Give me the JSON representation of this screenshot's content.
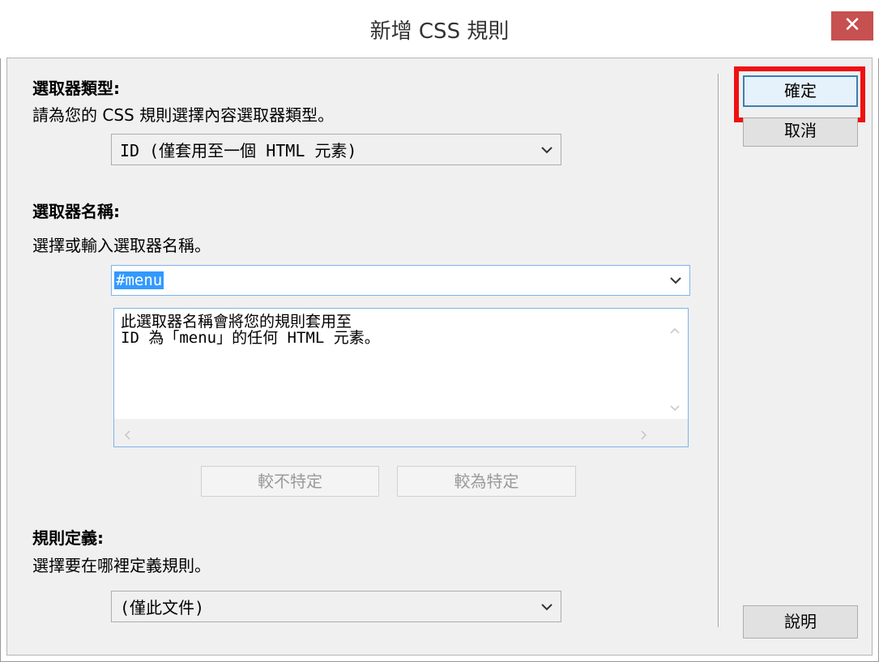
{
  "window": {
    "title": "新增 CSS 規則",
    "close_glyph": "✕"
  },
  "selector_type": {
    "heading": "選取器類型:",
    "description": "請為您的 CSS 規則選擇內容選取器類型。",
    "selected": "ID (僅套用至一個 HTML 元素)"
  },
  "selector_name": {
    "heading": "選取器名稱:",
    "description": "選擇或輸入選取器名稱。",
    "value": "#menu",
    "explanation_line1": "此選取器名稱會將您的規則套用至",
    "explanation_line2": "ID 為「menu」的任何 HTML 元素。",
    "less_specific_label": "較不特定",
    "more_specific_label": "較為特定"
  },
  "rule_definition": {
    "heading": "規則定義:",
    "description": "選擇要在哪裡定義規則。",
    "selected": "(僅此文件)"
  },
  "buttons": {
    "ok": "確定",
    "cancel": "取消",
    "help": "說明"
  },
  "colors": {
    "close_button": "#c75050",
    "highlight_box": "#ee1111",
    "selection": "#3399ff",
    "dialog_bg": "#f0f0f0"
  },
  "icons": {
    "dropdown": "chevron-down-icon",
    "scroll_up": "chevron-up-icon",
    "scroll_down": "chevron-down-icon",
    "scroll_left": "chevron-left-icon",
    "scroll_right": "chevron-right-icon",
    "close": "close-icon"
  }
}
